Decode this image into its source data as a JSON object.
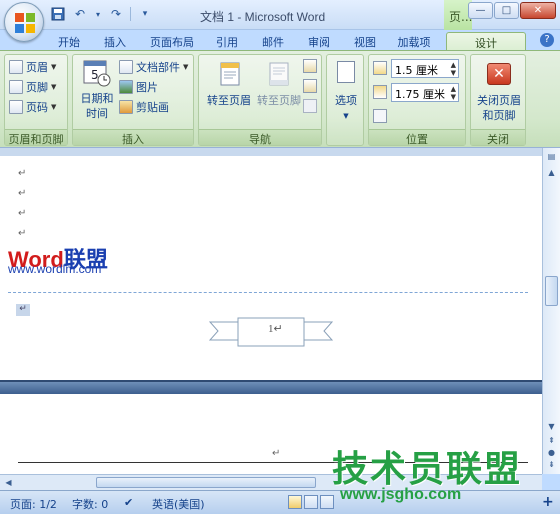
{
  "window": {
    "title": "文档 1 - Microsoft Word",
    "context_tab_title": "页...",
    "buttons": {
      "minimize": "—",
      "maximize": "□",
      "close": "✕"
    }
  },
  "qat": {
    "save_icon": "save-icon",
    "undo": "↶",
    "redo": "↷",
    "more": "▾"
  },
  "tabs": [
    "开始",
    "插入",
    "页面布局",
    "引用",
    "邮件",
    "审阅",
    "视图",
    "加载项",
    "设计"
  ],
  "active_tab": "设计",
  "ribbon": {
    "header_footer": {
      "header": "页眉",
      "footer": "页脚",
      "page_number": "页码",
      "label": "页眉和页脚"
    },
    "insert": {
      "date_time_line1": "日期和",
      "date_time_line2": "时间",
      "doc_parts": "文档部件",
      "picture": "图片",
      "clipart": "剪贴画",
      "label": "插入"
    },
    "navigation": {
      "goto_header": "转至页眉",
      "goto_footer": "转至页脚",
      "label": "导航"
    },
    "options": {
      "options": "选项"
    },
    "position": {
      "header_dist": "1.5 厘米",
      "footer_dist": "1.75 厘米",
      "label": "位置"
    },
    "close": {
      "close_line1": "关闭页眉",
      "close_line2": "和页脚",
      "label": "关闭"
    }
  },
  "document": {
    "logo_word": "Word",
    "logo_cn": "联盟",
    "logo_url": "www.wordlm.com",
    "para_mark": "↵",
    "page_number_field": "1↵"
  },
  "status": {
    "page": "页面: 1/2",
    "words": "字数: 0",
    "language": "英语(美国)",
    "zoom_plus": "+"
  },
  "watermark": {
    "cn": "技术员联盟",
    "url": "www.jsgho.com"
  },
  "colors": {
    "ribbon_green": "#d4e8cc",
    "title_blue": "#c9ddf6",
    "close_red": "#c7472f",
    "watermark_green": "#26a045"
  }
}
